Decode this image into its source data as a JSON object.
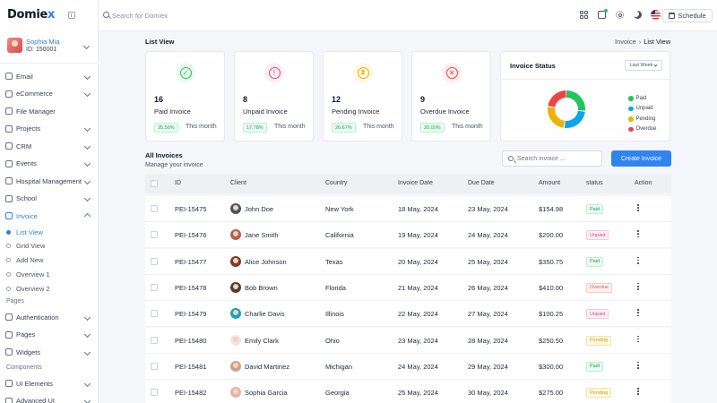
{
  "app": {
    "logo_main": "Domie",
    "logo_accent": "x"
  },
  "user": {
    "name": "Sophia Mia",
    "id": "ID: 150001"
  },
  "sidebar": {
    "items": [
      {
        "key": "email",
        "label": "Email",
        "icon": "mail-icon",
        "chevron": true
      },
      {
        "key": "ecommerce",
        "label": "eCommerce",
        "icon": "cart-icon",
        "chevron": true
      },
      {
        "key": "file-manager",
        "label": "File Manager",
        "icon": "folder-icon",
        "chevron": false
      },
      {
        "key": "projects",
        "label": "Projects",
        "icon": "briefcase-icon",
        "chevron": true
      },
      {
        "key": "crm",
        "label": "CRM",
        "icon": "chat-icon",
        "chevron": true
      },
      {
        "key": "events",
        "label": "Events",
        "icon": "trophy-icon",
        "chevron": true
      },
      {
        "key": "hospital",
        "label": "Hospital Management",
        "icon": "hospital-icon",
        "chevron": true
      },
      {
        "key": "school",
        "label": "School",
        "icon": "school-icon",
        "chevron": true
      },
      {
        "key": "invoice",
        "label": "Invoice",
        "icon": "invoice-icon",
        "chevron": true,
        "active": true
      }
    ],
    "invoice_sub": [
      "List View",
      "Grid View",
      "Add New",
      "Overview 1",
      "Overview 2"
    ],
    "pages_label": "Pages",
    "pages_items": [
      {
        "key": "authentication",
        "label": "Authentication",
        "icon": "lock-icon"
      },
      {
        "key": "pages",
        "label": "Pages",
        "icon": "file-icon"
      },
      {
        "key": "widgets",
        "label": "Widgets",
        "icon": "widget-icon"
      }
    ],
    "components_label": "Components",
    "components_items": [
      {
        "key": "ui-elements",
        "label": "UI Elements",
        "icon": "layers-icon"
      },
      {
        "key": "advanced-ui",
        "label": "Advanced UI",
        "icon": "sparkle-icon"
      }
    ]
  },
  "header": {
    "search_placeholder": "Search for Domiex",
    "schedule_label": "Schedule"
  },
  "page": {
    "title": "List View",
    "breadcrumb": [
      "Invoice",
      "List View"
    ]
  },
  "stats": [
    {
      "count": "16",
      "label": "Paid Invoice",
      "pct": "35.56%",
      "period": "This month",
      "icon": "check-circle-icon",
      "color": "#22c55e",
      "bg": "#eafaf0",
      "pct_bg": "#ecfdf3",
      "pct_border": "#bbf0cf"
    },
    {
      "count": "8",
      "label": "Unpaid Invoice",
      "pct": "17.78%",
      "period": "This month",
      "icon": "alert-circle-icon",
      "color": "#e0487a",
      "bg": "#fdeef4",
      "pct_bg": "#ecfdf3",
      "pct_border": "#bbf0cf"
    },
    {
      "count": "12",
      "label": "Pending Invoice",
      "pct": "26.67%",
      "period": "This month",
      "icon": "hourglass-icon",
      "color": "#eab308",
      "bg": "#fff8e1",
      "pct_bg": "#ecfdf3",
      "pct_border": "#bbf0cf"
    },
    {
      "count": "9",
      "label": "Overdue Invoice",
      "pct": "20.00%",
      "period": "This month",
      "icon": "x-icon",
      "color": "#ef4444",
      "bg": "#fdeeee",
      "pct_bg": "#ecfdf3",
      "pct_border": "#bbf0cf"
    }
  ],
  "status_card": {
    "title": "Invoice Status",
    "range": "Last Week",
    "legend": [
      {
        "label": "Paid",
        "color": "#22c55e"
      },
      {
        "label": "Unpaid",
        "color": "#0ea5e9"
      },
      {
        "label": "Pending",
        "color": "#eab308"
      },
      {
        "label": "Overdue",
        "color": "#ef4444"
      }
    ]
  },
  "invoices": {
    "title": "All Invoices",
    "subtitle": "Manage your invoice",
    "search_placeholder": "Search invoice ...",
    "create_label": "Create Invoice",
    "columns": [
      "ID",
      "Client",
      "Country",
      "Invoice Date",
      "Due Date",
      "Amount",
      "status",
      "Action"
    ],
    "rows": [
      {
        "id": "PEI-15475",
        "client": "John Doe",
        "country": "New York",
        "invoice_date": "18 May, 2024",
        "due_date": "23 May, 2024",
        "amount": "$154.98",
        "status": "Paid",
        "status_class": "paid",
        "avatar": "#4b5563"
      },
      {
        "id": "PEI-15476",
        "client": "Jane Smith",
        "country": "California",
        "invoice_date": "19 May, 2024",
        "due_date": "24 May, 2024",
        "amount": "$200.00",
        "status": "Unpaid",
        "status_class": "unpaid",
        "avatar": "#b45f4a"
      },
      {
        "id": "PEI-15477",
        "client": "Alice Johnson",
        "country": "Texas",
        "invoice_date": "20 May, 2024",
        "due_date": "25 May, 2024",
        "amount": "$350.75",
        "status": "Paid",
        "status_class": "paid",
        "avatar": "#7c3a2a"
      },
      {
        "id": "PEI-15478",
        "client": "Bob Brown",
        "country": "Florida",
        "invoice_date": "21 May, 2024",
        "due_date": "26 May, 2024",
        "amount": "$410.00",
        "status": "Overdue",
        "status_class": "overdue",
        "avatar": "#5a3b2b"
      },
      {
        "id": "PEI-15479",
        "client": "Charlie Davis",
        "country": "Illinois",
        "invoice_date": "22 May, 2024",
        "due_date": "27 May, 2024",
        "amount": "$100.25",
        "status": "Unpaid",
        "status_class": "unpaid",
        "avatar": "#1aa4b8"
      },
      {
        "id": "PEI-15480",
        "client": "Emily Clark",
        "country": "Ohio",
        "invoice_date": "23 May, 2024",
        "due_date": "28 May, 2024",
        "amount": "$250.50",
        "status": "Pending",
        "status_class": "pending",
        "avatar": "#f1e4dc"
      },
      {
        "id": "PEI-15481",
        "client": "David Martinez",
        "country": "Michigan",
        "invoice_date": "24 May, 2024",
        "due_date": "29 May, 2024",
        "amount": "$300.00",
        "status": "Paid",
        "status_class": "paid",
        "avatar": "#c9a28c"
      },
      {
        "id": "PEI-15482",
        "client": "Sophia Garcia",
        "country": "Georgia",
        "invoice_date": "25 May, 2024",
        "due_date": "30 May, 2024",
        "amount": "$275.00",
        "status": "Pending",
        "status_class": "pending",
        "avatar": "#e0b6a3"
      }
    ]
  }
}
